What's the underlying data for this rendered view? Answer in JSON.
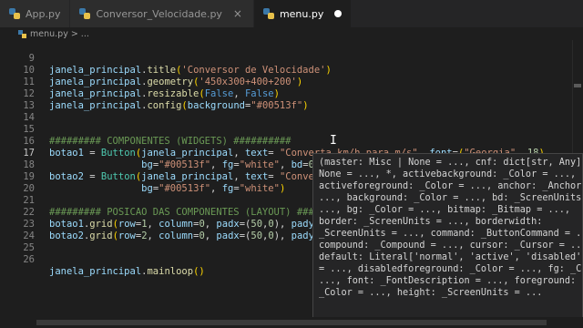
{
  "tabs": [
    {
      "label": "App.py",
      "active": false
    },
    {
      "label": "Conversor_Velocidade.py",
      "active": false
    },
    {
      "label": "menu.py",
      "active": true,
      "modified": true
    }
  ],
  "tab_close_glyph": "×",
  "breadcrumb": {
    "file": "menu.py",
    "separator": ">",
    "tail": "..."
  },
  "code_lines": [
    {
      "num": "9",
      "html_key": "l9"
    },
    {
      "num": "10",
      "html_key": "l10"
    },
    {
      "num": "11",
      "html_key": "l11"
    },
    {
      "num": "12",
      "html_key": "l12"
    },
    {
      "num": "13",
      "html_key": "l13"
    },
    {
      "num": "14",
      "html_key": "l14"
    },
    {
      "num": "15",
      "html_key": "l15"
    },
    {
      "num": "16",
      "html_key": "l16"
    },
    {
      "num": "17",
      "html_key": "l17"
    },
    {
      "num": "18",
      "html_key": "l18"
    },
    {
      "num": "19",
      "html_key": "l19"
    },
    {
      "num": "20",
      "html_key": "l20"
    },
    {
      "num": "21",
      "html_key": "l21"
    },
    {
      "num": "22",
      "html_key": "l22"
    },
    {
      "num": "23",
      "html_key": "l23"
    },
    {
      "num": "24",
      "html_key": "l24"
    },
    {
      "num": "25",
      "html_key": "l25"
    },
    {
      "num": "26",
      "html_key": "l26"
    }
  ],
  "code": {
    "l9": "janela_principal.title('Conversor de Velocidade')",
    "l10": "janela_principal.geometry('450x300+400+200')",
    "l11": "janela_principal.resizable(False, False)",
    "l12": "janela_principal.config(background=\"#00513f\")",
    "l15": "######### COMPONENTES (WIDGETS) ##########",
    "l16a": "botao1 = Button(janela_principal, text= \"Converta km/h para m/s\", font=(\"Georgia\", 18),",
    "l16b": "bg=\"#00513f\", fg=\"white\", bd=0, )",
    "l17a": "botao2 = Button(janela_principal, text= \"Convert",
    "l17b": "bg=\"#00513f\", fg=\"white\")",
    "l20": "######### POSICAO DAS COMPONENTES (LAYOUT) #####",
    "l21": "botao1.grid(row=1, column=0, padx=(50,0), pady=(",
    "l22": "botao2.grid(row=2, column=0, padx=(50,0), pady=(",
    "l26": "janela_principal.mainloop()"
  },
  "popup_lines": [
    "(master: Misc | None = ..., cnf: dict[str, Any]",
    "None = ..., *, activebackground: _Color = ...,",
    "activeforeground: _Color = ..., anchor: _Anchor =",
    "..., background: _Color = ..., bd: _ScreenUnits =",
    "..., bg: _Color = ..., bitmap: _Bitmap = ...,",
    "border: _ScreenUnits = ..., borderwidth:",
    "_ScreenUnits = ..., command: _ButtonCommand = ...,",
    "compound: _Compound = ..., cursor: _Cursor = ...,",
    "default: Literal['normal', 'active', 'disabled']",
    "= ..., disabledforeground: _Color = ..., fg: _Colo",
    "..., font: _FontDescription = ..., foreground:",
    "_Color = ..., height: _ScreenUnits = ..."
  ],
  "colors": {
    "background": "#1e1e1e",
    "tab_bar": "#252526",
    "variable": "#9cdcfe",
    "function": "#dcdcaa",
    "class": "#4ec9b0",
    "string": "#ce9178",
    "keyword": "#569cd6",
    "number": "#b5cea8",
    "comment": "#6a9955"
  }
}
